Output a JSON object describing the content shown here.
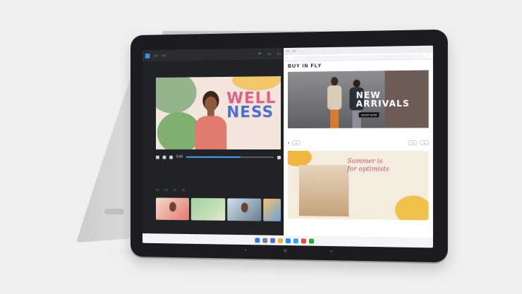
{
  "editor": {
    "headline_line1": "WELL",
    "headline_line2": "NESS",
    "timecode": "0:00",
    "progress_fraction": 0.62
  },
  "browser": {
    "brand": "BUY IN FLY",
    "hero_line1": "NEW",
    "hero_line2": "ARRIVALS",
    "cta": "SHOP NOW",
    "promo_line1": "Summer is",
    "promo_line2": "for optimists"
  },
  "icons": [
    "app-logo-icon",
    "play-icon",
    "pause-icon",
    "skip-back-icon",
    "skip-forward-icon",
    "windows-start-icon",
    "search-icon",
    "edge-icon",
    "folder-icon",
    "store-icon"
  ],
  "colors": {
    "accent_blue": "#4aa3ff",
    "wellness_pink": "#e35d86",
    "wellness_blue": "#4c6fd4",
    "promo_pink": "#c0536e",
    "device_body": "#1b1c1f"
  }
}
